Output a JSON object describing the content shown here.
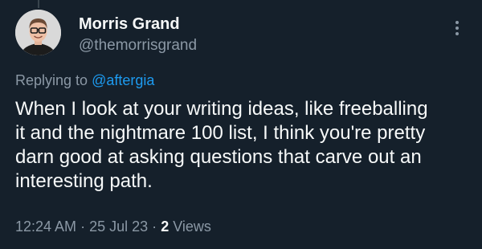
{
  "colors": {
    "background": "#15202b",
    "primary_text": "#f7f9f9",
    "secondary_text": "#8b98a5",
    "accent": "#1d9bf0"
  },
  "author": {
    "display_name": "Morris Grand",
    "handle": "@themorrisgrand",
    "avatar_icon": "profile-photo-man-with-glasses"
  },
  "more_menu_icon": "vertical-ellipsis-icon",
  "reply": {
    "prefix": "Replying to",
    "mention": "@aftergia"
  },
  "tweet": {
    "lines": [
      "When I look at your writing ideas, like freeballing",
      "it and the nightmare 100 list, I think you're pretty",
      "darn good at asking questions that carve out an",
      "interesting path."
    ]
  },
  "meta": {
    "time": "12:24 AM",
    "separator": "·",
    "date": "25 Jul 23",
    "views_count": "2",
    "views_label": "Views"
  }
}
